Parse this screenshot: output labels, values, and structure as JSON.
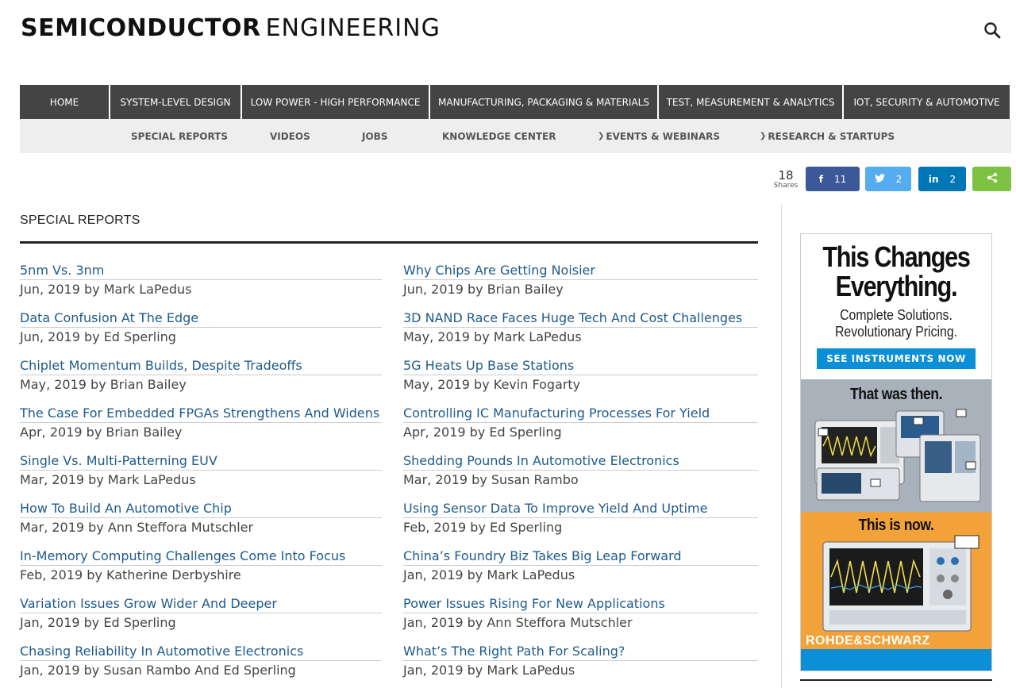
{
  "site": {
    "logo_bold": "SEMICONDUCTOR",
    "logo_light": "ENGINEERING"
  },
  "nav_main": [
    "HOME",
    "SYSTEM-LEVEL DESIGN",
    "LOW POWER - HIGH PERFORMANCE",
    "MANUFACTURING, PACKAGING & MATERIALS",
    "TEST, MEASUREMENT & ANALYTICS",
    "IOT, SECURITY & AUTOMOTIVE"
  ],
  "nav_sub": [
    {
      "label": "SPECIAL REPORTS",
      "has_dropdown": false
    },
    {
      "label": "VIDEOS",
      "has_dropdown": false
    },
    {
      "label": "JOBS",
      "has_dropdown": false
    },
    {
      "label": "KNOWLEDGE CENTER",
      "has_dropdown": false
    },
    {
      "label": "EVENTS & WEBINARS",
      "has_dropdown": true
    },
    {
      "label": "RESEARCH & STARTUPS",
      "has_dropdown": true
    }
  ],
  "share": {
    "total": "18",
    "total_label": "Shares",
    "facebook": {
      "icon": "facebook-icon",
      "count": "11",
      "color": "#3b5998"
    },
    "twitter": {
      "icon": "twitter-icon",
      "count": "2",
      "color": "#55acee"
    },
    "linkedin": {
      "icon": "linkedin-icon",
      "count": "2",
      "color": "#0077b5"
    },
    "sharethis": {
      "icon": "share-icon",
      "color": "#7dc242"
    }
  },
  "section": {
    "title": "SPECIAL REPORTS"
  },
  "articles_left": [
    {
      "title": "5nm Vs. 3nm",
      "meta": "Jun, 2019 by Mark LaPedus"
    },
    {
      "title": "Data Confusion At The Edge",
      "meta": "Jun, 2019 by Ed Sperling"
    },
    {
      "title": "Chiplet Momentum Builds, Despite Tradeoffs",
      "meta": "May, 2019 by Brian Bailey"
    },
    {
      "title": "The Case For Embedded FPGAs Strengthens And Widens",
      "meta": "Apr, 2019 by Brian Bailey"
    },
    {
      "title": "Single Vs. Multi-Patterning EUV",
      "meta": "Mar, 2019 by Mark LaPedus"
    },
    {
      "title": "How To Build An Automotive Chip",
      "meta": "Mar, 2019 by Ann Steffora Mutschler"
    },
    {
      "title": "In-Memory Computing Challenges Come Into Focus",
      "meta": "Feb, 2019 by Katherine Derbyshire"
    },
    {
      "title": "Variation Issues Grow Wider And Deeper",
      "meta": "Jan, 2019 by Ed Sperling"
    },
    {
      "title": "Chasing Reliability In Automotive Electronics",
      "meta": "Jan, 2019 by Susan Rambo And Ed Sperling"
    }
  ],
  "articles_right": [
    {
      "title": "Why Chips Are Getting Noisier",
      "meta": "Jun, 2019 by Brian Bailey"
    },
    {
      "title": "3D NAND Race Faces Huge Tech And Cost Challenges",
      "meta": "May, 2019 by Mark LaPedus"
    },
    {
      "title": "5G Heats Up Base Stations",
      "meta": "May, 2019 by Kevin Fogarty"
    },
    {
      "title": "Controlling IC Manufacturing Processes For Yield",
      "meta": "Apr, 2019 by Ed Sperling"
    },
    {
      "title": "Shedding Pounds In Automotive Electronics",
      "meta": "Mar, 2019 by Susan Rambo"
    },
    {
      "title": "Using Sensor Data To Improve Yield And Uptime",
      "meta": "Feb, 2019 by Ed Sperling"
    },
    {
      "title": "China’s Foundry Biz Takes Big Leap Forward",
      "meta": "Jan, 2019 by Mark LaPedus"
    },
    {
      "title": "Power Issues Rising For New Applications",
      "meta": "Jan, 2019 by Ann Steffora Mutschler"
    },
    {
      "title": "What’s The Right Path For Scaling?",
      "meta": "Jan, 2019 by Mark LaPedus"
    }
  ],
  "ad": {
    "headline_1": "This Changes",
    "headline_2": "Everything.",
    "subline_1": "Complete Solutions.",
    "subline_2": "Revolutionary Pricing.",
    "cta": "SEE INSTRUMENTS NOW",
    "then_label": "That was then.",
    "now_label": "This is now.",
    "brand": "ROHDE&SCHWARZ",
    "accent_color": "#0b8fd6",
    "now_color": "#f3a23a"
  }
}
